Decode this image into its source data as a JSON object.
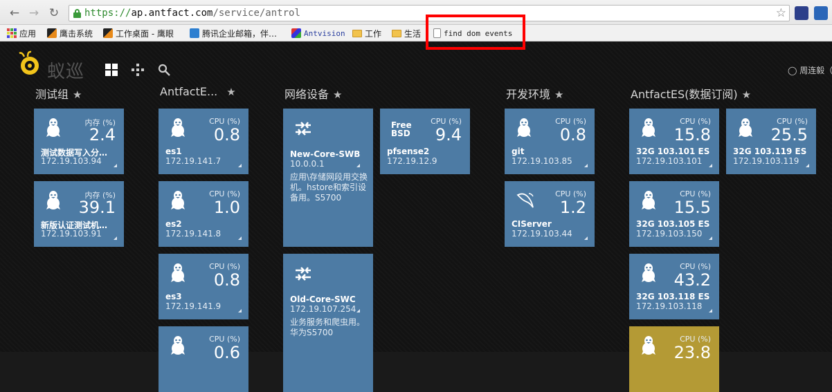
{
  "browser": {
    "url_scheme": "https://",
    "url_host": "ap.antfact.com",
    "url_path": "/service/antrol",
    "bookmarks": [
      {
        "label": "应用",
        "icon": "apps-grid-icon"
      },
      {
        "label": "鹰击系统",
        "icon": "site-icon"
      },
      {
        "label": "工作桌面 - 鹰眼",
        "icon": "site-icon"
      },
      {
        "label": "腾讯企业邮箱，伴…",
        "icon": "mail-icon"
      },
      {
        "label": "Antvision",
        "icon": "cube-icon"
      },
      {
        "label": "工作",
        "icon": "folder-icon"
      },
      {
        "label": "生活",
        "icon": "folder-icon"
      },
      {
        "label": "find dom events",
        "icon": "page-icon"
      }
    ]
  },
  "app": {
    "logo_text": "蚁巡",
    "user_name": "周连毅（"
  },
  "groups": [
    {
      "title": "测试组",
      "tiles": [
        {
          "metric_label": "内存 (%)",
          "value": "2.4",
          "name": "测试数据写入分…",
          "ip": "172.19.103.94",
          "os": "linux"
        },
        {
          "metric_label": "内存 (%)",
          "value": "39.1",
          "name": "新版认证测试机…",
          "ip": "172.19.103.91",
          "os": "linux"
        }
      ]
    },
    {
      "title": "AntfactE...",
      "tiles": [
        {
          "metric_label": "CPU (%)",
          "value": "0.8",
          "name": "es1",
          "ip": "172.19.141.7",
          "os": "linux"
        },
        {
          "metric_label": "CPU (%)",
          "value": "1.0",
          "name": "es2",
          "ip": "172.19.141.8",
          "os": "linux"
        },
        {
          "metric_label": "CPU (%)",
          "value": "0.8",
          "name": "es3",
          "ip": "172.19.141.9",
          "os": "linux"
        },
        {
          "metric_label": "CPU (%)",
          "value": "0.6",
          "name": "",
          "ip": "",
          "os": "linux"
        }
      ]
    },
    {
      "title": "网络设备",
      "switches": [
        {
          "name": "New-Core-SWB",
          "ip": "10.0.0.1",
          "desc": "应用\\存储网段用交换机。hstore和索引设备用。S5700"
        },
        {
          "name": "Old-Core-SWC",
          "ip": "172.19.107.254",
          "desc": "业务服务和爬虫用。华为S5700"
        }
      ],
      "extra_tile": {
        "os_label_line1": "Free",
        "os_label_line2": "BSD",
        "metric_label": "CPU (%)",
        "value": "9.4",
        "name": "pfsense2",
        "ip": "172.19.12.9"
      }
    },
    {
      "title": "开发环境",
      "tiles": [
        {
          "metric_label": "CPU (%)",
          "value": "0.8",
          "name": "git",
          "ip": "172.19.103.85",
          "os": "linux"
        },
        {
          "metric_label": "CPU (%)",
          "value": "1.2",
          "name": "CIServer",
          "ip": "172.19.103.44",
          "os": "mysql"
        }
      ]
    },
    {
      "title": "AntfactES(数据订阅)",
      "tiles_left": [
        {
          "metric_label": "CPU (%)",
          "value": "15.8",
          "name": "32G 103.101 ES",
          "ip": "172.19.103.101",
          "os": "linux"
        },
        {
          "metric_label": "CPU (%)",
          "value": "15.5",
          "name": "32G 103.105 ES",
          "ip": "172.19.103.150",
          "os": "linux"
        },
        {
          "metric_label": "CPU (%)",
          "value": "43.2",
          "name": "32G 103.118 ES",
          "ip": "172.19.103.118",
          "os": "linux"
        },
        {
          "metric_label": "CPU (%)",
          "value": "23.8",
          "name": "",
          "ip": "",
          "os": "linux"
        }
      ],
      "tiles_right": [
        {
          "metric_label": "CPU (%)",
          "value": "25.5",
          "name": "32G 103.119 ES",
          "ip": "172.19.103.119",
          "os": "linux"
        }
      ]
    }
  ],
  "colors": {
    "tile_blue": "#4d7ba4",
    "tile_gold": "#b49a35",
    "highlight_red": "#ff0000",
    "page_bg": "#131313"
  }
}
